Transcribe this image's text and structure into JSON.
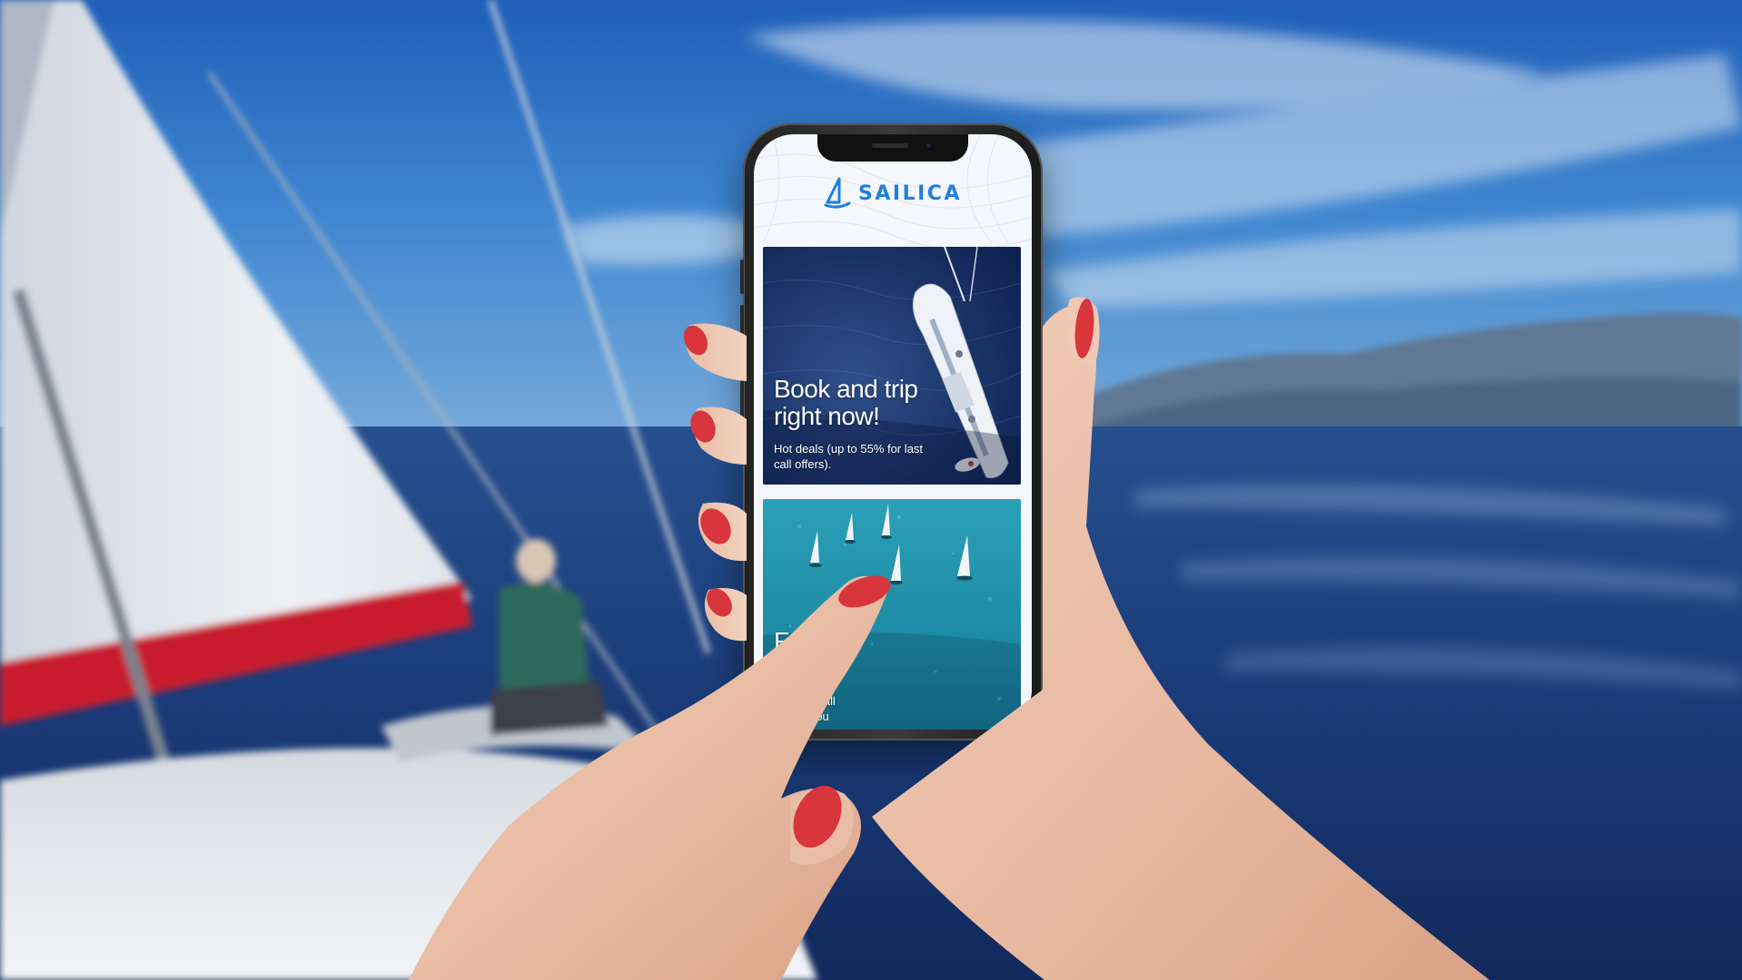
{
  "app": {
    "brand_name": "SAILICA",
    "logo_icon": "sail-logo-icon"
  },
  "cards": [
    {
      "title": "Book and trip\nright now!",
      "subtitle": "Hot deals (up to 55% for last\ncall offers).",
      "image": "aerial-sailboat-photo"
    },
    {
      "title": "F       of all\n       es!",
      "subtitle": "     dal list of all\n     s near you",
      "image": "sailboat-regatta-photo"
    }
  ],
  "colors": {
    "brand_blue": "#1f7fe0",
    "sky": "#2a6cc0",
    "sea": "#1a3b78",
    "nail_red": "#d8353c",
    "sail_stripe_red": "#c81f2d"
  }
}
